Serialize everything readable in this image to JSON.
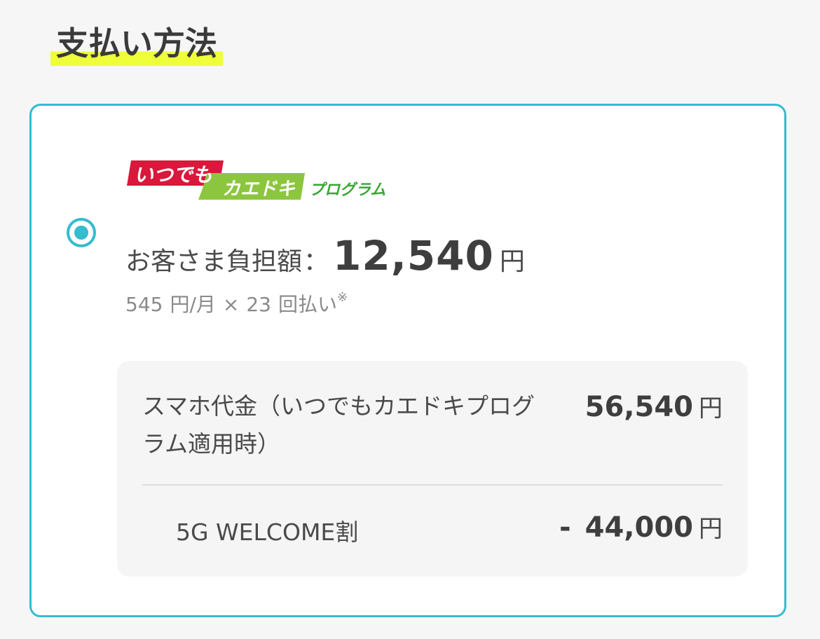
{
  "section": {
    "title": "支払い方法"
  },
  "payment_option": {
    "selected": true,
    "logo": {
      "part1": "いつでも",
      "part2": "カエドキ",
      "part3": "プログラム",
      "colors": {
        "red": "#d9183b",
        "green": "#8cc63f",
        "text_green": "#3aa535"
      }
    },
    "amount_label": "お客さま負担額",
    "amount_separator": "：",
    "amount_value": "12,540",
    "amount_unit": "円",
    "installment": {
      "monthly": "545",
      "monthly_unit": "円/月",
      "times_sign": "×",
      "count": "23",
      "count_unit": "回払い",
      "note_mark": "※"
    }
  },
  "breakdown": {
    "rows": [
      {
        "label": "スマホ代金（いつでもカエドキプログラム適用時）",
        "value": "56,540",
        "unit": "円"
      },
      {
        "label": "5G WELCOME割",
        "sign": "-",
        "value": "44,000",
        "unit": "円"
      }
    ]
  },
  "colors": {
    "accent": "#34bccf",
    "highlight": "#eeff3a",
    "background": "#f6f6f6"
  }
}
